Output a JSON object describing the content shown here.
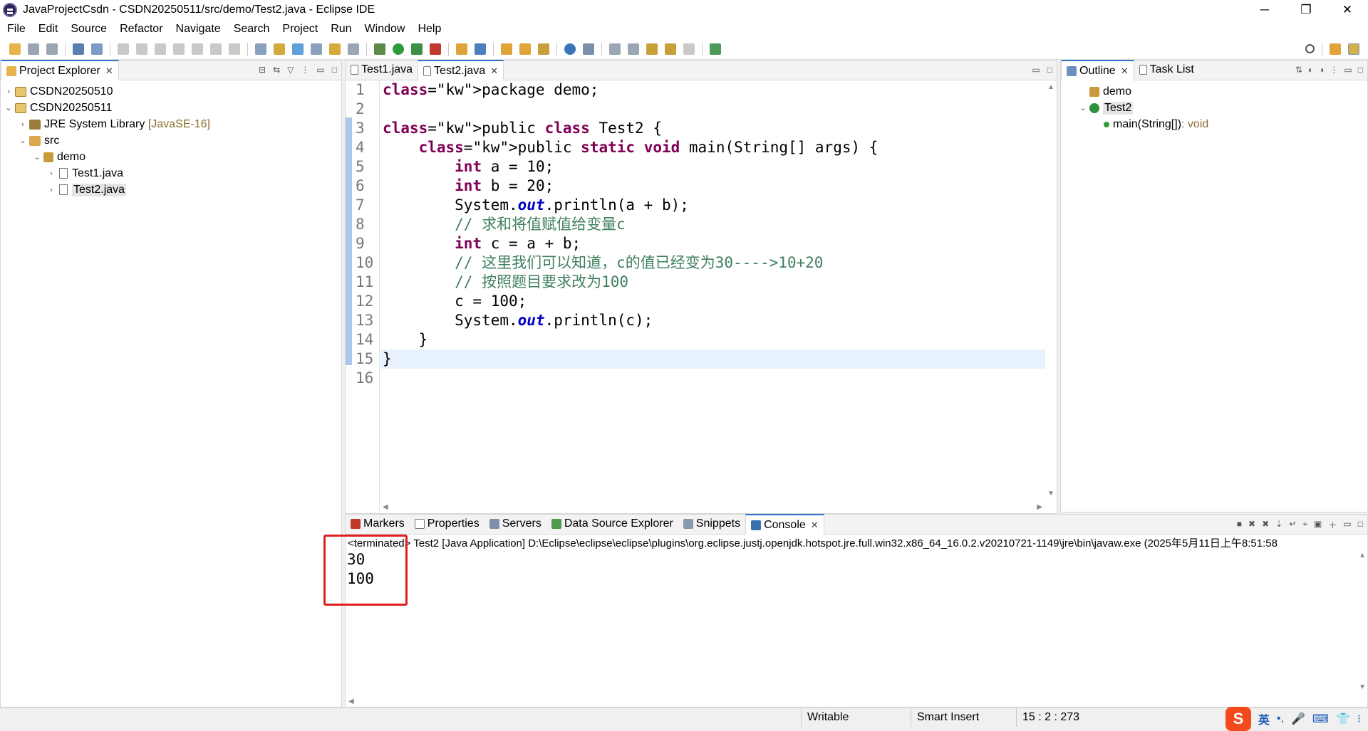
{
  "window": {
    "title": "JavaProjectCsdn - CSDN20250511/src/demo/Test2.java - Eclipse IDE",
    "minimize": "─",
    "restore": "❐",
    "close": "✕"
  },
  "menu": [
    "File",
    "Edit",
    "Source",
    "Refactor",
    "Navigate",
    "Search",
    "Project",
    "Run",
    "Window",
    "Help"
  ],
  "project_explorer": {
    "tab_label": "Project Explorer",
    "items": [
      {
        "label": "CSDN20250510",
        "suffix": ""
      },
      {
        "label": "CSDN20250511",
        "suffix": ""
      },
      {
        "label": "JRE System Library",
        "suffix": "[JavaSE-16]"
      },
      {
        "label": "src",
        "suffix": ""
      },
      {
        "label": "demo",
        "suffix": ""
      },
      {
        "label": "Test1.java",
        "suffix": ""
      },
      {
        "label": "Test2.java",
        "suffix": ""
      }
    ]
  },
  "editor": {
    "tabs": [
      "Test1.java",
      "Test2.java"
    ],
    "line_numbers": [
      "1",
      "2",
      "3",
      "4",
      "5",
      "6",
      "7",
      "8",
      "9",
      "10",
      "11",
      "12",
      "13",
      "14",
      "15",
      "16"
    ],
    "lines": [
      "package demo;",
      "",
      "public class Test2 {",
      "    public static void main(String[] args) {",
      "        int a = 10;",
      "        int b = 20;",
      "        System.out.println(a + b);",
      "        // 求和将值赋值给变量c",
      "        int c = a + b;",
      "        // 这里我们可以知道，c的值已经变为30---->10+20",
      "        // 按照题目要求改为100",
      "        c = 100;",
      "        System.out.println(c);",
      "    }",
      "}",
      ""
    ]
  },
  "outline": {
    "tabs": [
      "Outline",
      "Task List"
    ],
    "items": [
      {
        "label": "demo"
      },
      {
        "label": "Test2"
      },
      {
        "label": "main(String[])",
        "type": " : void"
      }
    ]
  },
  "console": {
    "tabs": [
      "Markers",
      "Properties",
      "Servers",
      "Data Source Explorer",
      "Snippets",
      "Console"
    ],
    "info": "<terminated> Test2 [Java Application] D:\\Eclipse\\eclipse\\eclipse\\plugins\\org.eclipse.justj.openjdk.hotspot.jre.full.win32.x86_64_16.0.2.v20210721-1149\\jre\\bin\\javaw.exe  (2025年5月11日上午8:51:58",
    "output": [
      "30",
      "100"
    ]
  },
  "statusbar": {
    "writable": "Writable",
    "insert_mode": "Smart Insert",
    "position": "15 : 2 : 273",
    "ime_lang": "英"
  },
  "colors": {
    "keyword": "#7f0055",
    "comment": "#3f7f5f",
    "field": "#0000c0",
    "accent": "#3173c6",
    "highlight_box": "#e02020"
  }
}
